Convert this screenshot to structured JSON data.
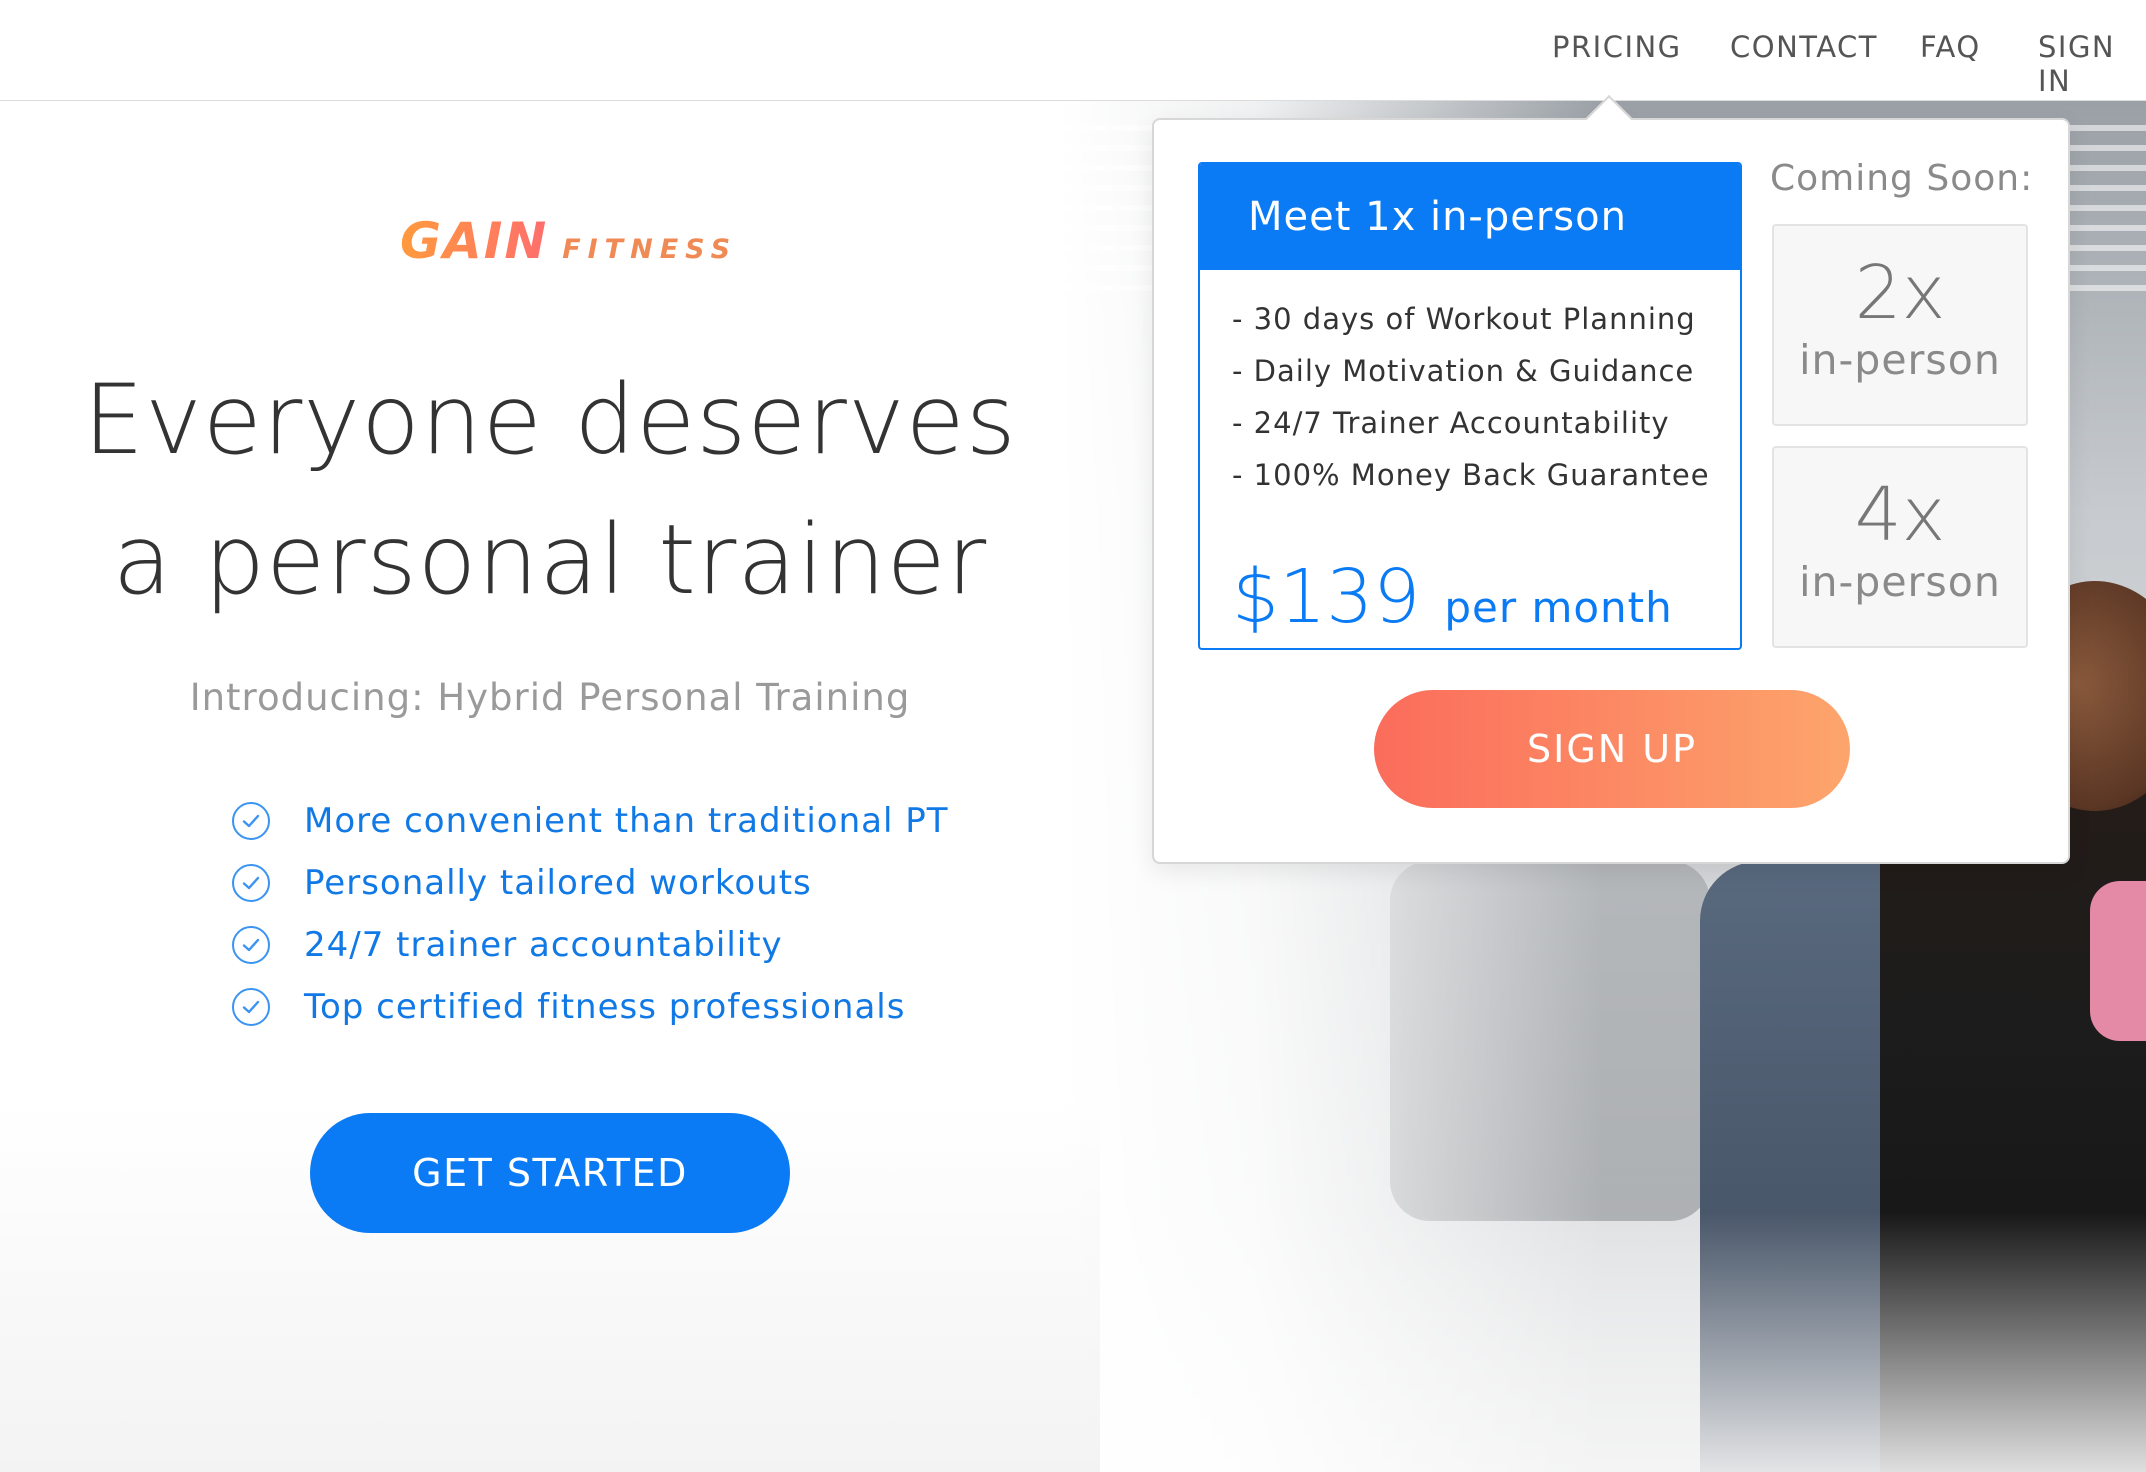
{
  "nav": {
    "items": [
      {
        "label": "PRICING"
      },
      {
        "label": "CONTACT"
      },
      {
        "label": "FAQ"
      },
      {
        "label": "SIGN IN"
      }
    ]
  },
  "brand": {
    "logo_word": "GAIN",
    "logo_sub": "FITNESS"
  },
  "hero": {
    "headline_line1": "Everyone deserves",
    "headline_line2": "a personal trainer",
    "subheadline": "Introducing: Hybrid Personal Training",
    "features": [
      "More convenient than traditional PT",
      "Personally tailored workouts",
      "24/7 trainer accountability",
      "Top certified fitness professionals"
    ],
    "cta_label": "GET STARTED"
  },
  "pricing": {
    "plan_title": "Meet 1x in-person",
    "plan_features": [
      "- 30 days of Workout Planning",
      "- Daily Motivation & Guidance",
      "- 24/7 Trainer Accountability",
      "- 100% Money Back Guarantee"
    ],
    "price": "$139",
    "price_unit": "per month",
    "coming_soon_label": "Coming Soon:",
    "coming_soon_plans": [
      {
        "count": "2x",
        "label": "in-person"
      },
      {
        "count": "4x",
        "label": "in-person"
      }
    ],
    "signup_label": "SIGN UP"
  },
  "colors": {
    "primary": "#0a7bf5",
    "signup_gradient_start": "#fb6c5b",
    "signup_gradient_end": "#fda56c",
    "muted_text": "#9a9a9a"
  }
}
